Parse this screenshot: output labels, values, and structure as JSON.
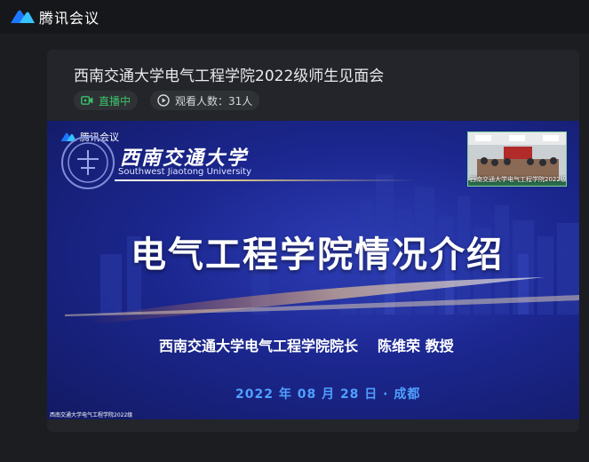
{
  "app": {
    "name": "腾讯会议"
  },
  "meeting": {
    "title": "西南交通大学电气工程学院2022级师生见面会",
    "live_status": "直播中",
    "viewers": "观看人数：31人"
  },
  "slide": {
    "app_logo": "腾讯会议",
    "university_cn": "西南交通大学",
    "university_en": "Southwest Jiaotong University",
    "title": "电气工程学院情况介绍",
    "presenter_role": "西南交通大学电气工程学院院长",
    "presenter_name": "陈维荣 教授",
    "date": "2022 年 08 月 28 日 · 成都",
    "watermark": "西南交通大学电气工程学院2022级"
  },
  "pip": {
    "label": "西南交通大学电气工程学院2022级"
  },
  "colors": {
    "brand_blue": "#1e78ff",
    "live_green": "#39c26a",
    "slide_blue": "#1c2790",
    "date_blue": "#4fa0ff"
  },
  "icons": {
    "app_logo": "tencent-meeting-logo-icon",
    "live": "video-camera-icon",
    "viewers": "play-circle-icon"
  }
}
